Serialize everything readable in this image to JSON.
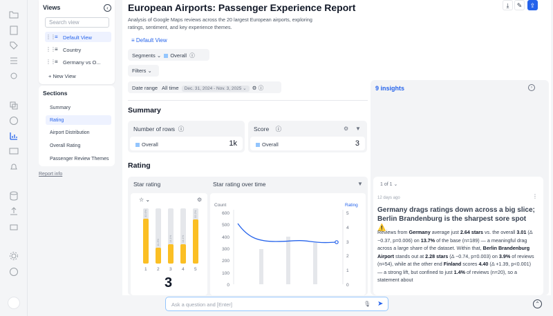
{
  "rail_icons": [
    "folder-icon",
    "document-icon",
    "tag-icon",
    "list-icon",
    "settings-cog-icon",
    "layers-icon",
    "help-icon",
    "chart-icon",
    "video-icon",
    "bell-icon",
    "database-icon",
    "upload-icon",
    "gift-icon",
    "gear-icon",
    "info-icon",
    "chat-icon"
  ],
  "views": {
    "title": "Views",
    "search_placeholder": "Search view",
    "items": [
      "Default View",
      "Country",
      "Germany vs O..."
    ],
    "new_view": "+ New View"
  },
  "sections": {
    "title": "Sections",
    "items": [
      "Summary",
      "Rating",
      "Airport Distribution",
      "Overall Rating",
      "Passenger Review Themes"
    ]
  },
  "report_info": "Report info",
  "report": {
    "title": "European Airports: Passenger Experience Report",
    "subtitle": "Analysis of Google Maps reviews across the 20 largest European airports, exploring ratings, sentiment, and key experience themes.",
    "default_view": "Default View"
  },
  "filters": {
    "segments_label": "Segments",
    "segment_value": "Overall",
    "filters_label": "Filters",
    "date_range_label": "Date range",
    "date_mode": "All time",
    "date_value": "Dec. 31, 2024 - Nov. 3, 2025"
  },
  "summary": {
    "heading": "Summary",
    "rows_card": {
      "label": "Number of rows",
      "series": "Overall",
      "value": "1k"
    },
    "score_card": {
      "label": "Score",
      "series": "Overall",
      "value": "3"
    }
  },
  "rating": {
    "heading": "Rating",
    "star_card_label": "Star rating",
    "over_time_label": "Star rating over time",
    "big_value": "3",
    "left_axis_title": "Count",
    "right_axis_title": "Rating",
    "left_ticks": [
      "600",
      "500",
      "400",
      "300",
      "200",
      "100",
      "0"
    ],
    "right_ticks": [
      "5",
      "4",
      "3",
      "2",
      "1",
      "0"
    ]
  },
  "chart_data": {
    "type": "bar",
    "categories": [
      "1",
      "2",
      "3",
      "4",
      "5"
    ],
    "values": [
      32.6,
      11.3,
      14.1,
      14.1,
      32.2
    ],
    "ylim": [
      0,
      40
    ]
  },
  "insights": {
    "title": "9 insights",
    "pager": "1 of 1",
    "age": "12 days ago",
    "headline": "Germany drags ratings down across a big slice; Berlin Brandenburg is the sharpest sore spot ⚠️",
    "body_1a": "Reviews from ",
    "body_1b": "Germany",
    "body_1c": " average just ",
    "body_1d": "2.64 stars",
    "body_1e": " vs. the overall ",
    "body_1f": "3.01",
    "body_1g": " (Δ −0.37, p=0.006) on ",
    "body_1h": "13.7%",
    "body_1i": " of the base (n=189) — a meaningful drag across a large share of the dataset. Within that, ",
    "body_1j": "Berlin Brandenburg Airport",
    "body_1k": " stands out at ",
    "body_1l": "2.28 stars",
    "body_1m": " (Δ −0.74, p=0.003) on ",
    "body_1n": "3.9%",
    "body_1o": " of reviews (n=54), while at the other end ",
    "body_1p": "Finland",
    "body_1q": " scores ",
    "body_1r": "4.40",
    "body_1s": " (Δ +1.39, p<0.001) — a strong lift, but confined to just ",
    "body_1t": "1.4%",
    "body_1u": " of reviews (n=20), so a statement about"
  },
  "ask": {
    "placeholder": "Ask a question and [Enter]"
  },
  "colors": {
    "accent": "#2563eb",
    "bar": "#fbbf24",
    "line": "#2563eb"
  }
}
